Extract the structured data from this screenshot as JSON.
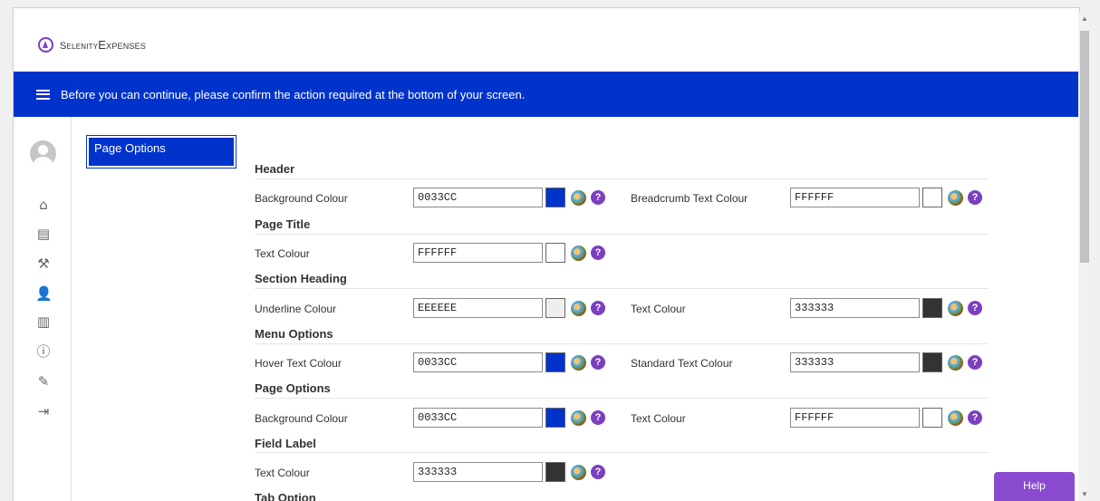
{
  "app": {
    "logo_small": "Selenity",
    "logo_big": "Expenses"
  },
  "banner": {
    "message": "Before you can continue, please confirm the action required at the bottom of your screen."
  },
  "nav": {
    "page_tab": "Page Options"
  },
  "help_label": "Help",
  "help_glyph": "?",
  "sections": {
    "header": {
      "title": "Header",
      "background_colour": {
        "label": "Background Colour",
        "value": "0033CC",
        "swatch": "#0033CC"
      },
      "breadcrumb_text_colour": {
        "label": "Breadcrumb Text Colour",
        "value": "FFFFFF",
        "swatch": "#FFFFFF"
      }
    },
    "page_title": {
      "title": "Page Title",
      "text_colour": {
        "label": "Text Colour",
        "value": "FFFFFF",
        "swatch": "#FFFFFF"
      }
    },
    "section_heading": {
      "title": "Section Heading",
      "underline_colour": {
        "label": "Underline Colour",
        "value": "EEEEEE",
        "swatch": "#EEEEEE"
      },
      "text_colour": {
        "label": "Text Colour",
        "value": "333333",
        "swatch": "#333333"
      }
    },
    "menu_options": {
      "title": "Menu Options",
      "hover_text_colour": {
        "label": "Hover Text Colour",
        "value": "0033CC",
        "swatch": "#0033CC"
      },
      "standard_text_colour": {
        "label": "Standard Text Colour",
        "value": "333333",
        "swatch": "#333333"
      }
    },
    "page_options": {
      "title": "Page Options",
      "background_colour": {
        "label": "Background Colour",
        "value": "0033CC",
        "swatch": "#0033CC"
      },
      "text_colour": {
        "label": "Text Colour",
        "value": "FFFFFF",
        "swatch": "#FFFFFF"
      }
    },
    "field_label": {
      "title": "Field Label",
      "text_colour": {
        "label": "Text Colour",
        "value": "333333",
        "swatch": "#333333"
      }
    },
    "tab_option": {
      "title": "Tab Option"
    }
  },
  "colors": {
    "accent": "#0033CC",
    "help_purple": "#7B3FC0"
  },
  "icons": [
    "home-icon",
    "list-icon",
    "tools-icon",
    "user-icon",
    "presentation-icon",
    "info-icon",
    "edit-icon",
    "logout-icon",
    "color-picker-icon",
    "help-icon"
  ]
}
